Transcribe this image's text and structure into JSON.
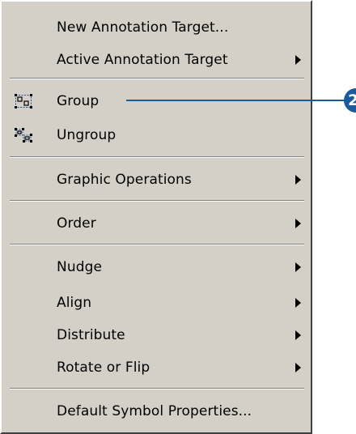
{
  "menu": {
    "items": [
      {
        "label": "New Annotation Target..."
      },
      {
        "label": "Active Annotation Target"
      },
      {
        "label": "Group",
        "icon": "group-icon"
      },
      {
        "label": "Ungroup",
        "icon": "ungroup-icon"
      },
      {
        "label": "Graphic Operations"
      },
      {
        "label": "Order"
      },
      {
        "label": "Nudge"
      },
      {
        "label": "Align"
      },
      {
        "label": "Distribute"
      },
      {
        "label": "Rotate or Flip"
      },
      {
        "label": "Default Symbol Properties..."
      }
    ]
  },
  "callout": {
    "number": "2",
    "color": "#1c5a9e"
  },
  "colors": {
    "menu_background": "#d4d0c8",
    "icon_accent": "#1f4f9e"
  }
}
